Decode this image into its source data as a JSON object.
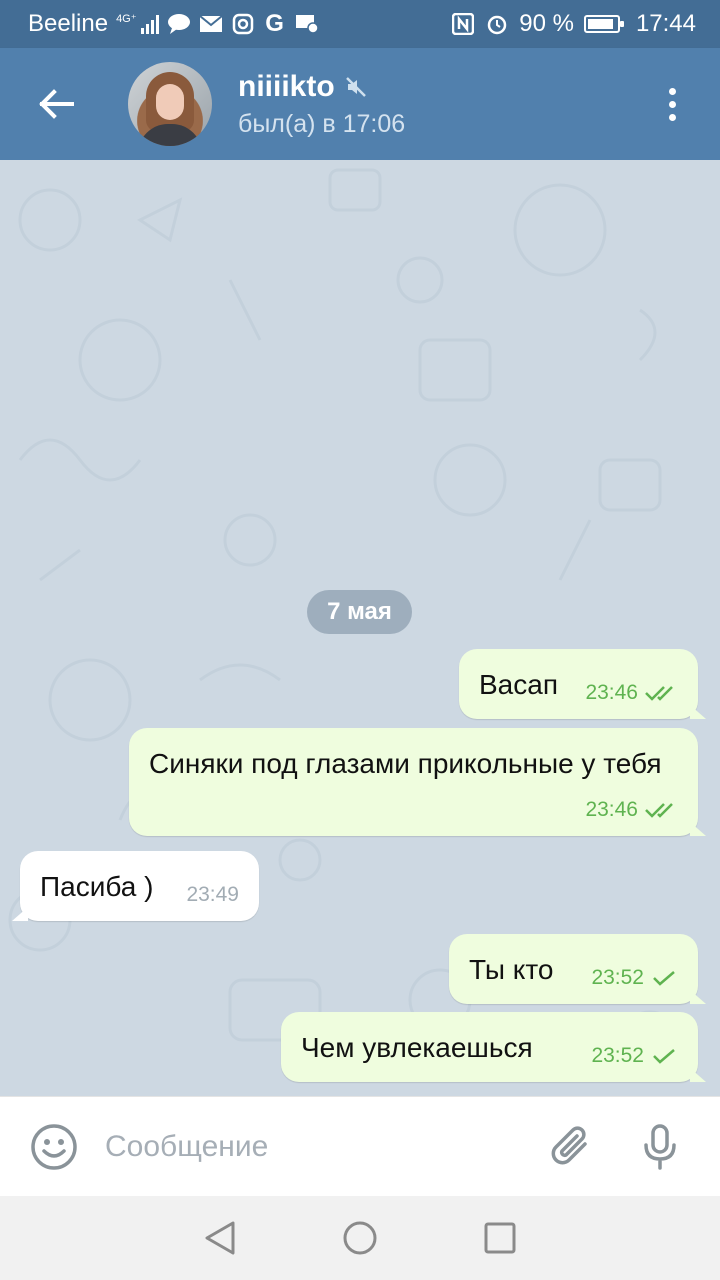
{
  "status_bar": {
    "carrier": "Beeline",
    "network_type": "4G⁺",
    "battery": "90 %",
    "battery_level": 0.9,
    "time": "17:44",
    "icons": [
      "signal-icon",
      "message-icon",
      "mail-icon",
      "instagram-icon",
      "google-icon",
      "mail-settings-icon",
      "nfc-icon",
      "alarm-icon",
      "battery-icon"
    ]
  },
  "header": {
    "chat_name": "niiiikto",
    "last_seen": "был(а) в 17:06",
    "muted": true
  },
  "chat": {
    "date_chip": "7 мая",
    "messages": [
      {
        "direction": "out",
        "text": "Васап",
        "time": "23:46",
        "status": "read"
      },
      {
        "direction": "out",
        "text": "Синяки под глазами прикольные у тебя",
        "time": "23:46",
        "status": "read"
      },
      {
        "direction": "in",
        "text": "Пасиба )",
        "time": "23:49"
      },
      {
        "direction": "out",
        "text": "Ты кто",
        "time": "23:52",
        "status": "sent"
      },
      {
        "direction": "out",
        "text": "Чем увлекаешься",
        "time": "23:52",
        "status": "sent"
      }
    ]
  },
  "input": {
    "placeholder": "Сообщение",
    "value": ""
  },
  "colors": {
    "status_bar": "#436d95",
    "header": "#5180ad",
    "chat_background": "#cdd8e2",
    "outgoing_bubble": "#effdde",
    "incoming_bubble": "#ffffff",
    "check_color": "#5fb350"
  }
}
